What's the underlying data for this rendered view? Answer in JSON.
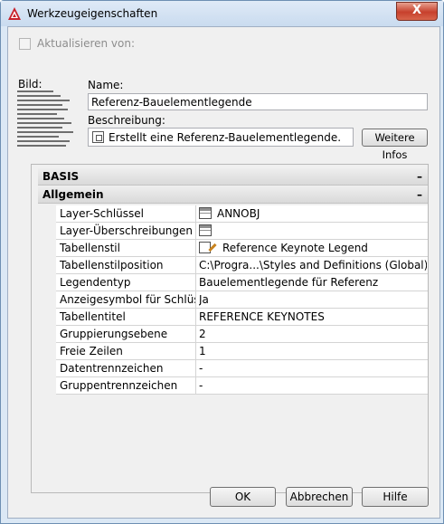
{
  "window": {
    "title": "Werkzeugeigenschaften",
    "close_glyph": "X"
  },
  "colors": {
    "accent": "#c7402c",
    "category_bg": "#d9d9d9",
    "border": "#6d8fb3"
  },
  "update_checkbox": {
    "label": "Aktualisieren von:",
    "checked": false,
    "enabled": false
  },
  "image": {
    "label": "Bild:"
  },
  "name": {
    "label": "Name:",
    "value": "Referenz-Bauelementlegende"
  },
  "description": {
    "label": "Beschreibung:",
    "value": "Erstellt eine Referenz-Bauelementlegende.",
    "icon": "text-field-icon"
  },
  "info_button": {
    "label": "Weitere Infos"
  },
  "property_grid": {
    "categories": [
      {
        "label": "BASIS",
        "toggle": "–"
      },
      {
        "label": "Allgemein",
        "toggle": "–"
      }
    ],
    "rows": [
      {
        "key": "Layer-Schlüssel",
        "value": "ANNOBJ",
        "icon": "table-icon"
      },
      {
        "key": "Layer-Überschreibungen",
        "value": "",
        "icon": "table-icon"
      },
      {
        "key": "Tabellenstil",
        "value": "Reference Keynote Legend",
        "icon": "table-style-icon"
      },
      {
        "key": "Tabellenstilposition",
        "value": "C:\\Progra...\\Styles and Definitions (Global).dwg"
      },
      {
        "key": "Legendentyp",
        "value": "Bauelementlegende für Referenz"
      },
      {
        "key": "Anzeigesymbol für Schlüssel",
        "value": "Ja"
      },
      {
        "key": "Tabellentitel",
        "value": "REFERENCE KEYNOTES"
      },
      {
        "key": "Gruppierungsebene",
        "value": "2"
      },
      {
        "key": "Freie Zeilen",
        "value": "1"
      },
      {
        "key": "Datentrennzeichen",
        "value": " -"
      },
      {
        "key": "Gruppentrennzeichen",
        "value": " -"
      }
    ]
  },
  "buttons": {
    "ok": "OK",
    "cancel": "Abbrechen",
    "help": "Hilfe"
  }
}
